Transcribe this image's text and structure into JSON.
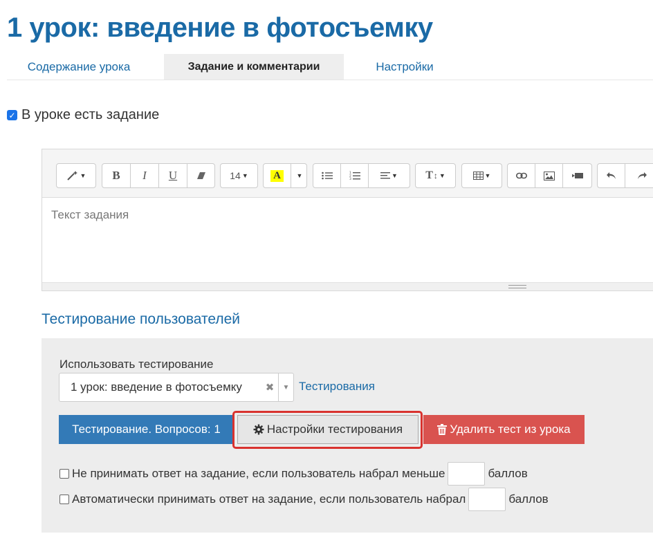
{
  "page": {
    "title": "1 урок: введение в фотосъемку"
  },
  "tabs": [
    {
      "label": "Содержание урока"
    },
    {
      "label": "Задание и комментарии"
    },
    {
      "label": "Настройки"
    }
  ],
  "has_task": {
    "label": "В уроке есть задание",
    "checked": true
  },
  "editor": {
    "font_size": "14",
    "highlight_label": "A",
    "textsize_label": "T",
    "placeholder": "Текст задания"
  },
  "testing": {
    "section_title": "Тестирование пользователей",
    "use_label": "Использовать тестирование",
    "selected_test": "1 урок: введение в фотосъемку",
    "tests_link": "Тестирования",
    "questions_button": "Тестирование. Вопросов: 1",
    "settings_button": "Настройки тестирования",
    "delete_button": "Удалить тест из урока",
    "cond1_text": "Не принимать ответ на задание, если пользователь набрал меньше",
    "cond1_suffix": "баллов",
    "cond2_text": "Автоматически принимать ответ на задание, если пользователь набрал",
    "cond2_suffix": "баллов"
  },
  "colors": {
    "primary": "#337ab7",
    "link": "#1a6aa6",
    "danger": "#d9534f",
    "highlight": "#d9322e"
  }
}
